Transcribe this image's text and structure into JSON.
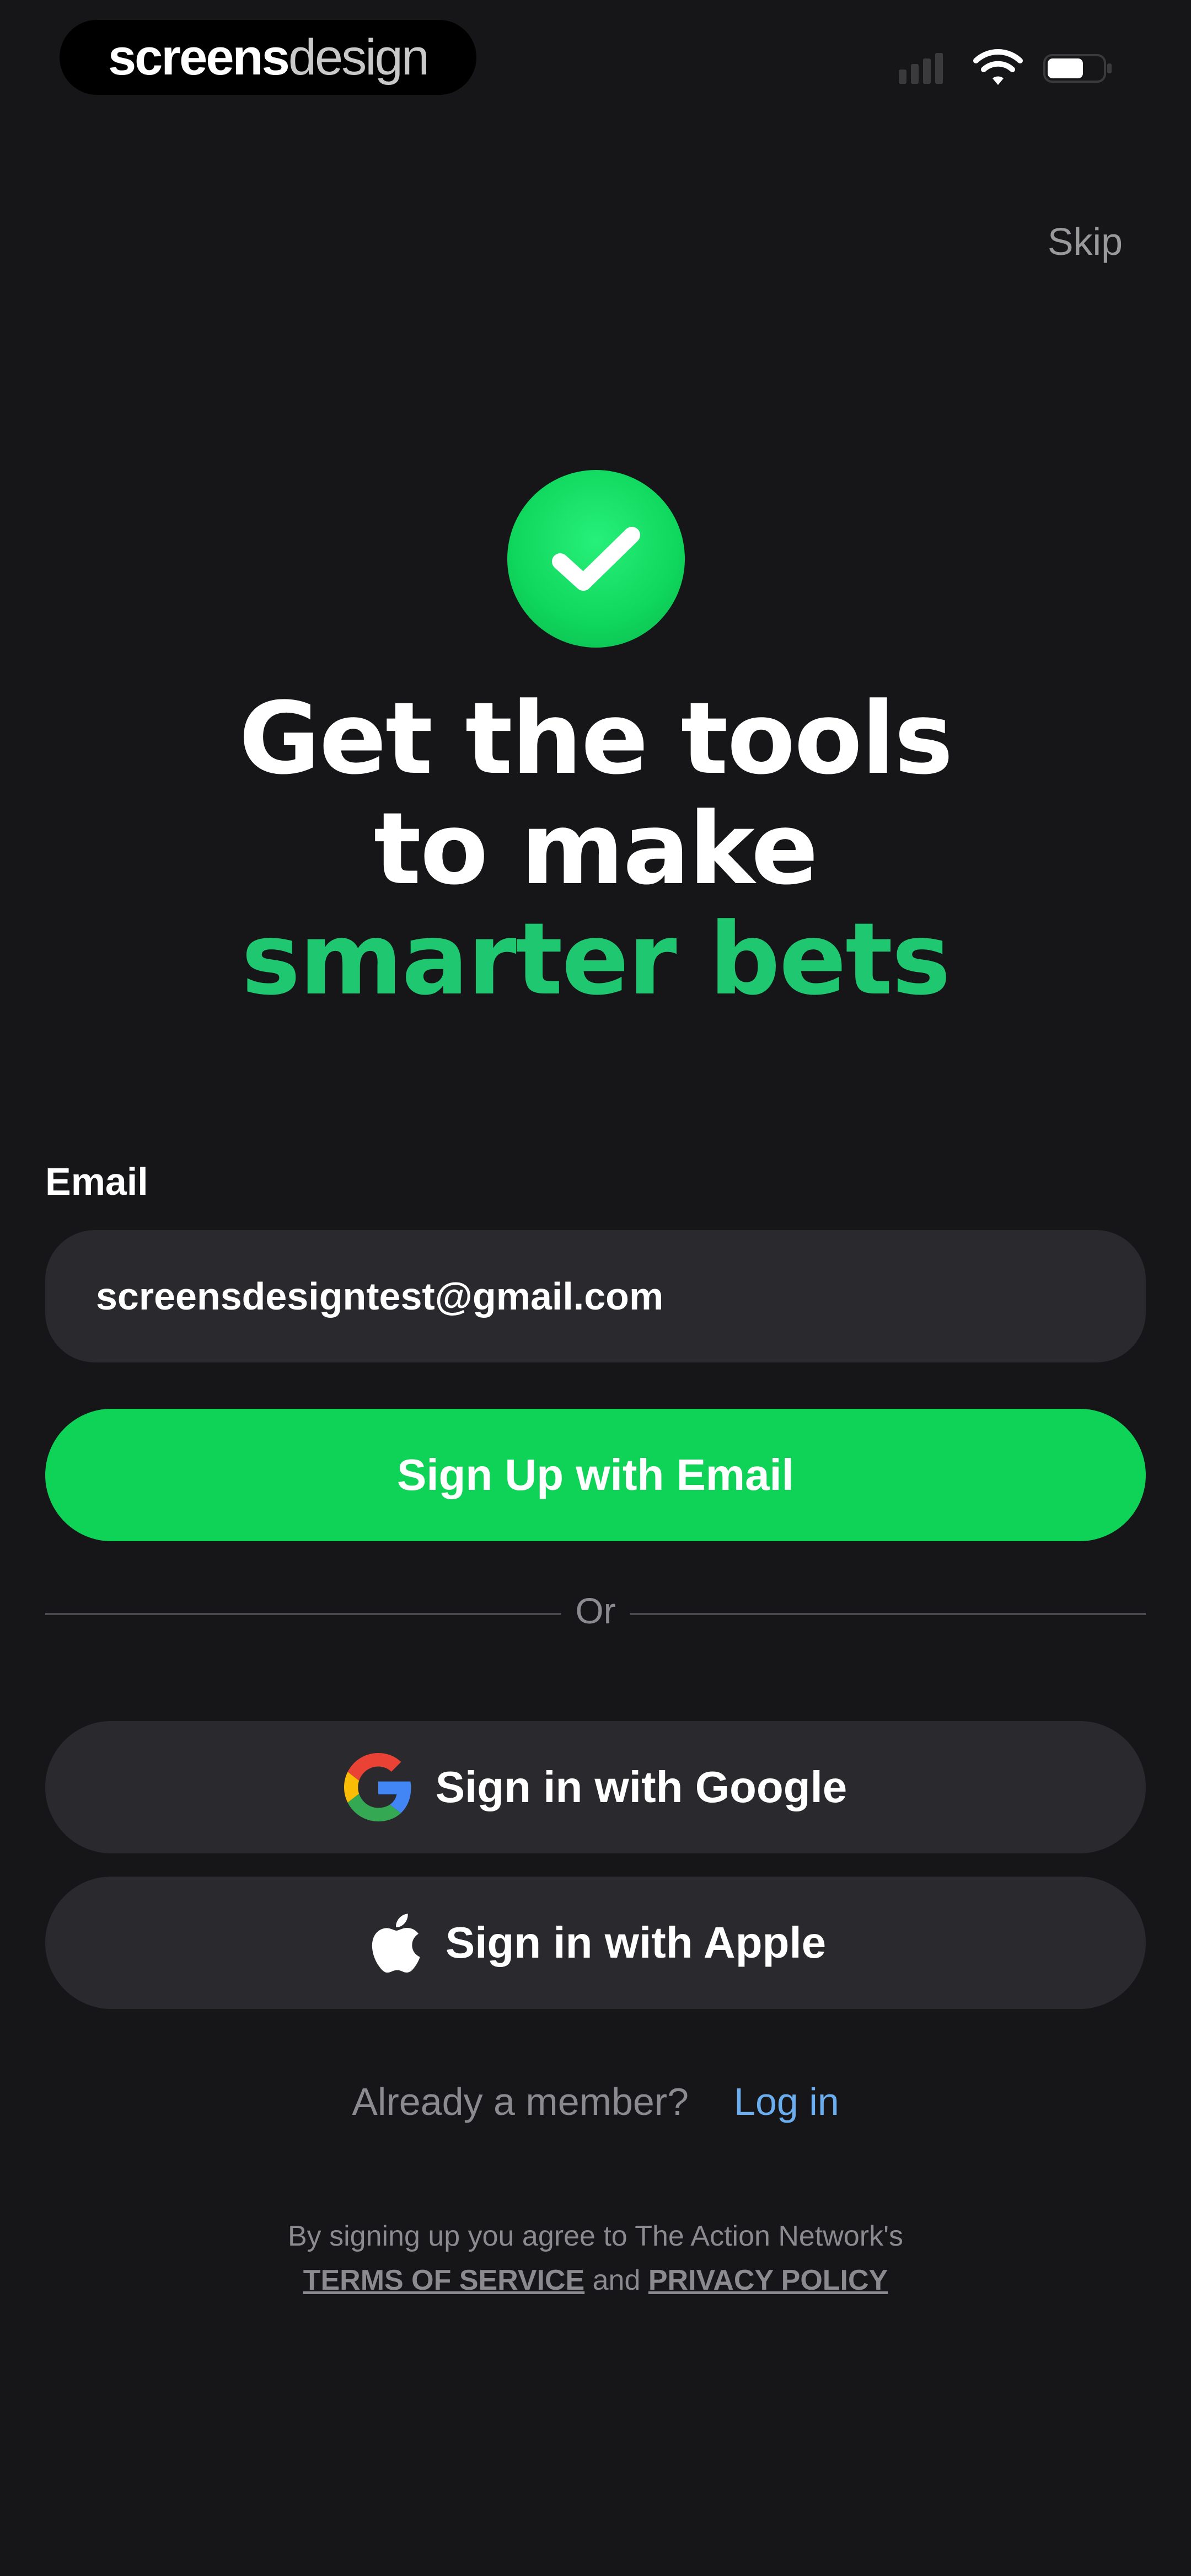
{
  "branding": {
    "part1": "screens",
    "part2": "design"
  },
  "status_bar": {
    "icons": [
      "signal-icon",
      "wifi-icon",
      "battery-icon"
    ]
  },
  "header": {
    "skip_label": "Skip"
  },
  "hero": {
    "icon": "check-icon",
    "line1": "Get the tools",
    "line2": "to make",
    "line3": "smarter bets"
  },
  "form": {
    "email_label": "Email",
    "email_value": "screensdesigntest@gmail.com",
    "signup_button": "Sign Up with Email",
    "or_label": "Or"
  },
  "social": {
    "google_label": "Sign in with Google",
    "google_icon": "google-icon",
    "apple_label": "Sign in with Apple",
    "apple_icon": "apple-icon"
  },
  "member": {
    "question": "Already a member?",
    "login_label": "Log in"
  },
  "legal": {
    "line1": "By signing up you agree to The Action Network's",
    "terms_label": "TERMS OF SERVICE",
    "and_text": "and",
    "privacy_label": "PRIVACY POLICY"
  },
  "colors": {
    "background": "#161619",
    "accent_green": "#0fd357",
    "headline_green": "#1ec770",
    "link_blue": "#6aaef0",
    "field_bg": "#2a2a2e"
  }
}
